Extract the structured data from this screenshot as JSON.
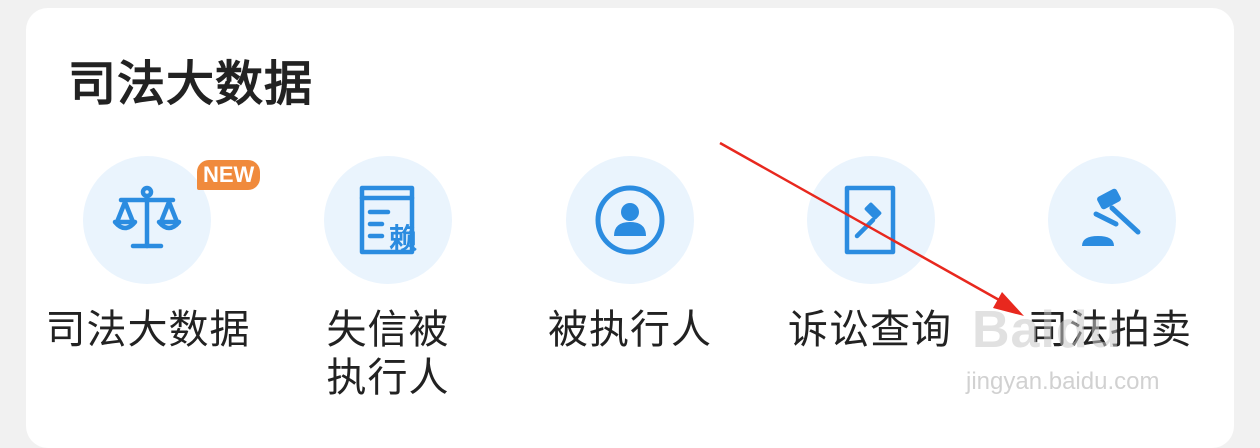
{
  "section": {
    "title": "司法大数据"
  },
  "badge": {
    "text": "NEW"
  },
  "items": [
    {
      "label": "司法大数据",
      "icon": "scales-icon"
    },
    {
      "label": "失信被执行人",
      "icon": "blacklist-document-icon",
      "icon_glyph": "赖"
    },
    {
      "label": "被执行人",
      "icon": "person-circle-icon"
    },
    {
      "label": "诉讼查询",
      "icon": "lawsuit-document-icon"
    },
    {
      "label": "司法拍卖",
      "icon": "gavel-icon"
    }
  ],
  "watermark": {
    "logo": "Baidu",
    "url": "jingyan.baidu.com"
  },
  "colors": {
    "icon_blue": "#2b8ce0",
    "icon_bg": "#eaf4fd",
    "badge": "#f08a3c",
    "arrow": "#e8281e",
    "text": "#222222"
  }
}
